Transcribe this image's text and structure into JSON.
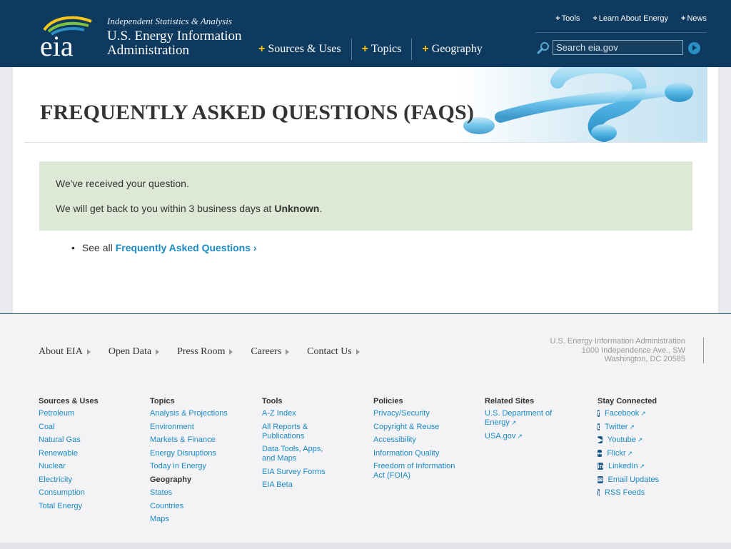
{
  "header": {
    "tagline": "Independent Statistics & Analysis",
    "agency_line1": "U.S. Energy Information",
    "agency_line2": "Administration",
    "logo_text": "eia",
    "main_nav": [
      "Sources & Uses",
      "Topics",
      "Geography"
    ],
    "util_nav": [
      "Tools",
      "Learn About Energy",
      "News"
    ],
    "search_placeholder": "Search eia.gov"
  },
  "page": {
    "title": "FREQUENTLY ASKED QUESTIONS (FAQS)",
    "notice_line1": "We've received your question.",
    "notice_line2_prefix": "We will get back to you within 3 business days at ",
    "notice_line2_bold": "Unknown",
    "notice_line2_suffix": ".",
    "see_all_prefix": "See all",
    "see_all_link": "Frequently Asked Questions ›"
  },
  "footer": {
    "nav": [
      "About EIA",
      "Open Data",
      "Press Room",
      "Careers",
      "Contact Us"
    ],
    "address": [
      "U.S. Energy Information Administration",
      "1000 Independence Ave., SW",
      "Washington, DC 20585"
    ],
    "columns": [
      {
        "heading": "Sources & Uses",
        "links": [
          "Petroleum",
          "Coal",
          "Natural Gas",
          "Renewable",
          "Nuclear",
          "Electricity",
          "Consumption",
          "Total Energy"
        ]
      },
      {
        "heading": "Topics",
        "links": [
          "Analysis & Projections",
          "Environment",
          "Markets & Finance",
          "Energy Disruptions",
          "Today in Energy"
        ],
        "subheading": "Geography",
        "sublinks": [
          "States",
          "Countries",
          "Maps"
        ]
      },
      {
        "heading": "Tools",
        "links": [
          "A-Z Index",
          "All Reports & Publications",
          "Data Tools, Apps, and Maps",
          "EIA Survey Forms",
          "EIA Beta"
        ]
      },
      {
        "heading": "Policies",
        "links": [
          "Privacy/Security",
          "Copyright & Reuse",
          "Accessibility",
          "Information Quality",
          "Freedom of Information Act (FOIA)"
        ]
      },
      {
        "heading": "Related Sites",
        "links": [
          "U.S. Department of Energy",
          "USA.gov"
        ]
      },
      {
        "heading": "Stay Connected",
        "links": [
          "Facebook",
          "Twitter",
          "Youtube",
          "Flickr",
          "LinkedIn",
          "Email Updates",
          "RSS Feeds"
        ]
      }
    ]
  },
  "colors": {
    "header_bg": "#0d3a5e",
    "link": "#1a8ac4",
    "notice_bg": "#dde8d6",
    "plus": "#f5c518"
  }
}
